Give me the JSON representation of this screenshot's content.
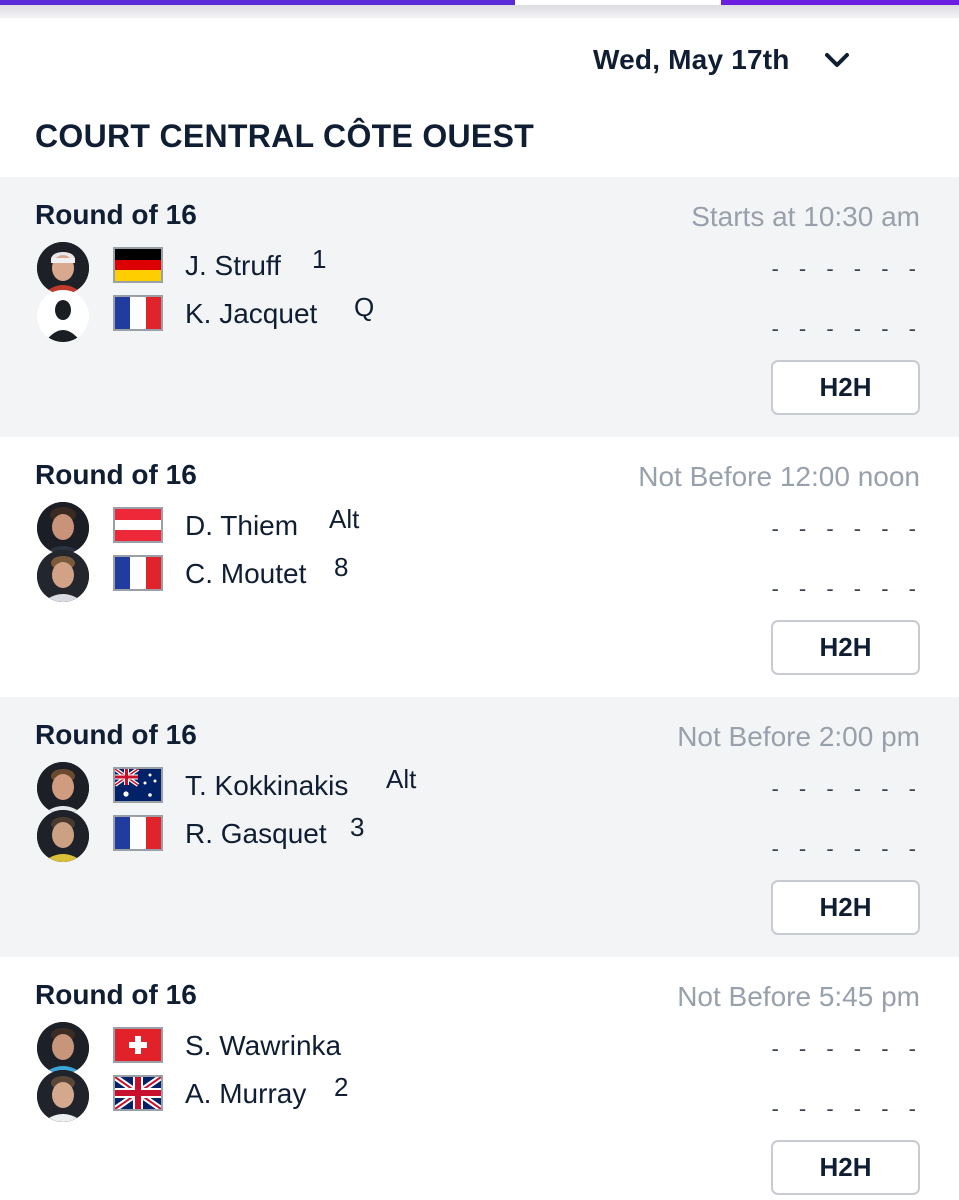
{
  "header": {
    "date_label": "Wed, May 17th",
    "chevron_icon": "chevron-down-icon"
  },
  "court": {
    "name": "COURT CENTRAL CÔTE OUEST"
  },
  "colors": {
    "accent": "#5b2ad8",
    "muted_text": "#98a1ab",
    "card_grey": "#f3f4f6"
  },
  "matches": [
    {
      "round": "Round of 16",
      "time": "Starts at 10:30 am",
      "h2h_label": "H2H",
      "players": [
        {
          "name": "J. Struff",
          "seed": "1",
          "country": "Germany",
          "flag_icon": "germany-flag-icon",
          "score": "- - - - - -"
        },
        {
          "name": "K. Jacquet",
          "seed": "Q",
          "country": "France",
          "flag_icon": "france-flag-icon",
          "score": "- - - - - -"
        }
      ]
    },
    {
      "round": "Round of 16",
      "time": "Not Before 12:00 noon",
      "h2h_label": "H2H",
      "players": [
        {
          "name": "D. Thiem",
          "seed": "Alt",
          "country": "Austria",
          "flag_icon": "austria-flag-icon",
          "score": "- - - - - -"
        },
        {
          "name": "C. Moutet",
          "seed": "8",
          "country": "France",
          "flag_icon": "france-flag-icon",
          "score": "- - - - - -"
        }
      ]
    },
    {
      "round": "Round of 16",
      "time": "Not Before 2:00 pm",
      "h2h_label": "H2H",
      "players": [
        {
          "name": "T. Kokkinakis",
          "seed": "Alt",
          "country": "Australia",
          "flag_icon": "australia-flag-icon",
          "score": "- - - - - -"
        },
        {
          "name": "R. Gasquet",
          "seed": "3",
          "country": "France",
          "flag_icon": "france-flag-icon",
          "score": "- - - - - -"
        }
      ]
    },
    {
      "round": "Round of 16",
      "time": "Not Before 5:45 pm",
      "h2h_label": "H2H",
      "players": [
        {
          "name": "S. Wawrinka",
          "seed": "",
          "country": "Switzerland",
          "flag_icon": "switzerland-flag-icon",
          "score": "- - - - - -"
        },
        {
          "name": "A. Murray",
          "seed": "2",
          "country": "Great Britain",
          "flag_icon": "united-kingdom-flag-icon",
          "score": "- - - - - -"
        }
      ]
    }
  ]
}
